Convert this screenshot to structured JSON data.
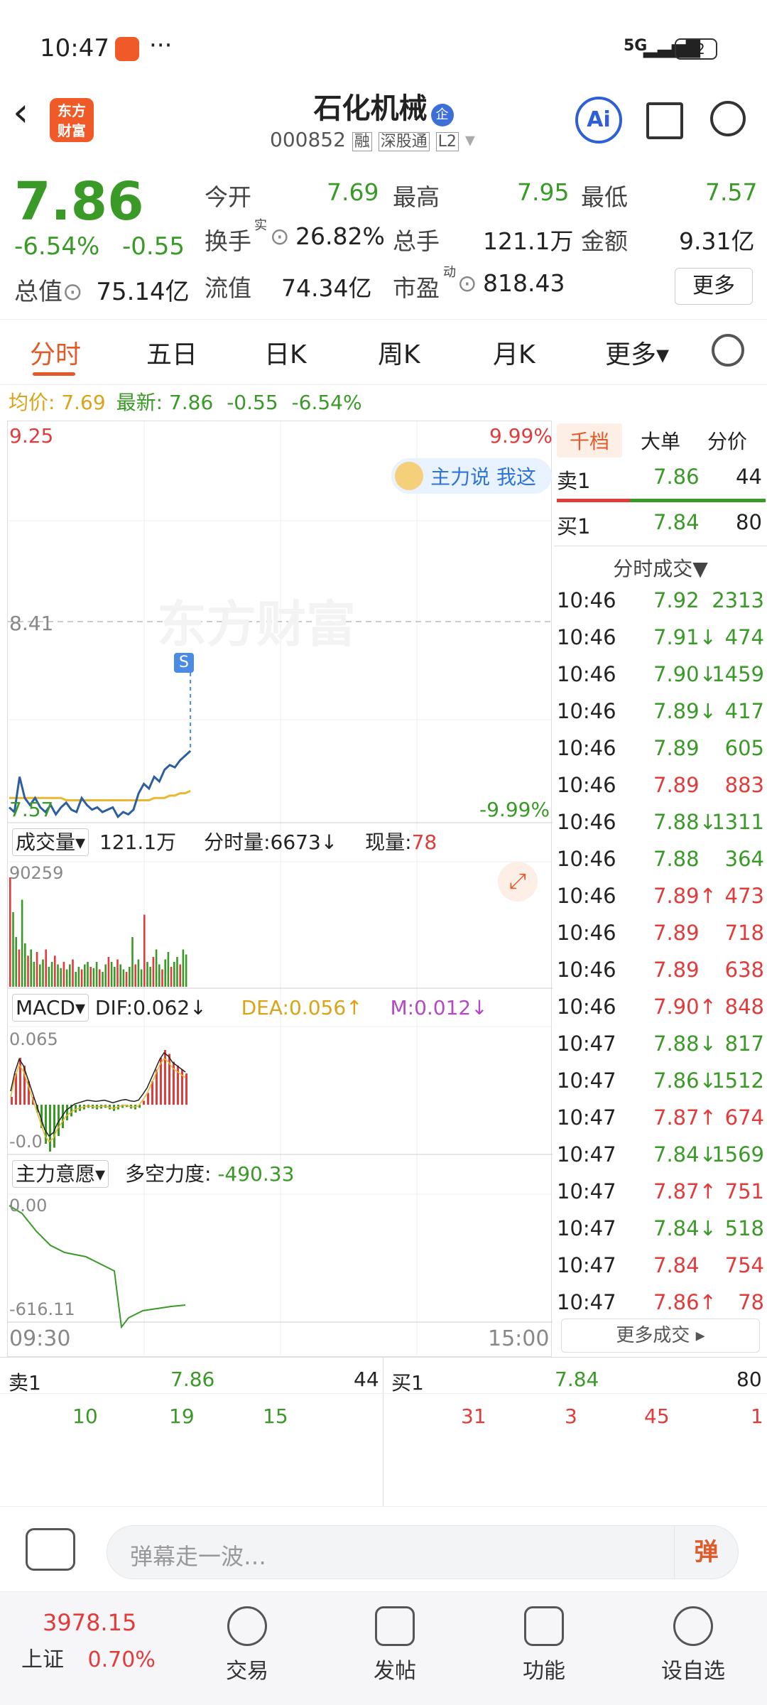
{
  "status": {
    "time": "10:47",
    "dots": "···",
    "network": "5G",
    "battery": "22"
  },
  "header": {
    "app_logo_top": "东方",
    "app_logo_bottom": "财富",
    "stock_name": "石化机械",
    "company_badge": "企",
    "code": "000852",
    "tag_margin": "融",
    "tag_connect": "深股通",
    "tag_l2": "L2"
  },
  "quote": {
    "price": "7.86",
    "change_pct": "-6.54%",
    "change": "-0.55",
    "open_label": "今开",
    "open": "7.69",
    "high_label": "最高",
    "high": "7.95",
    "low_label": "最低",
    "low": "7.57",
    "turnover_label": "换手",
    "turnover_sup": "实",
    "turnover": "26.82%",
    "volume_label": "总手",
    "volume": "121.1万",
    "amount_label": "金额",
    "amount": "9.31亿",
    "mcap_label": "总值",
    "mcap": "75.14亿",
    "float_label": "流值",
    "float": "74.34亿",
    "pe_label": "市盈",
    "pe_sup": "动",
    "pe": "818.43",
    "more": "更多"
  },
  "tabs": [
    "分时",
    "五日",
    "日K",
    "周K",
    "月K",
    "更多▾"
  ],
  "subline": {
    "avg_label": "均价:",
    "avg": "7.69",
    "latest_label": "最新:",
    "latest": "7.86",
    "chg": "-0.55",
    "pct": "-6.54%"
  },
  "chart": {
    "y_top": "9.25",
    "y_mid": "8.41",
    "y_bot": "7.57",
    "pct_top": "9.99%",
    "pct_bot": "-9.99%",
    "watermark": "东方财富",
    "banner": "主力说  我这",
    "marker": "S",
    "vol_label": "成交量",
    "vol_total": "121.1万",
    "fs_label": "分时量:",
    "fs_val": "6673↓",
    "now_label": "现量:",
    "now_val": "78",
    "vol_max": "90259",
    "macd_label": "MACD",
    "dif": "DIF:0.062↓",
    "dea": "DEA:0.056↑",
    "m": "M:0.012↓",
    "macd_top": "0.065",
    "macd_bot": "-0.0",
    "zl_label": "主力意愿",
    "dk_label": "多空力度:",
    "dk_val": "-490.33",
    "zl_top": "0.00",
    "zl_bot": "-616.11",
    "t_start": "09:30",
    "t_end": "15:00",
    "price_line": [
      7.62,
      7.6,
      7.75,
      7.66,
      7.63,
      7.66,
      7.62,
      7.6,
      7.63,
      7.59,
      7.62,
      7.64,
      7.61,
      7.6,
      7.66,
      7.63,
      7.61,
      7.62,
      7.6,
      7.61,
      7.62,
      7.58,
      7.6,
      7.59,
      7.61,
      7.68,
      7.72,
      7.7,
      7.75,
      7.73,
      7.78,
      7.8,
      7.79,
      7.82,
      7.84,
      7.86
    ],
    "avg_line": [
      7.66,
      7.66,
      7.66,
      7.66,
      7.66,
      7.66,
      7.66,
      7.66,
      7.66,
      7.66,
      7.66,
      7.65,
      7.65,
      7.65,
      7.65,
      7.65,
      7.65,
      7.65,
      7.65,
      7.65,
      7.65,
      7.65,
      7.65,
      7.65,
      7.65,
      7.65,
      7.65,
      7.65,
      7.66,
      7.66,
      7.66,
      7.67,
      7.67,
      7.68,
      7.68,
      7.69
    ]
  },
  "side": {
    "tabs": [
      "千档",
      "大单",
      "分价"
    ],
    "sell1": {
      "label": "卖1",
      "price": "7.86",
      "vol": "44"
    },
    "buy1": {
      "label": "买1",
      "price": "7.84",
      "vol": "80"
    },
    "ticks_title": "分时成交▼",
    "ticks": [
      {
        "t": "10:46",
        "p": "7.92",
        "v": "2313",
        "c": "green"
      },
      {
        "t": "10:46",
        "p": "7.91↓",
        "v": "474",
        "c": "green"
      },
      {
        "t": "10:46",
        "p": "7.90↓",
        "v": "1459",
        "c": "green"
      },
      {
        "t": "10:46",
        "p": "7.89↓",
        "v": "417",
        "c": "green"
      },
      {
        "t": "10:46",
        "p": "7.89",
        "v": "605",
        "c": "green"
      },
      {
        "t": "10:46",
        "p": "7.89",
        "v": "883",
        "c": "red"
      },
      {
        "t": "10:46",
        "p": "7.88↓",
        "v": "1311",
        "c": "green"
      },
      {
        "t": "10:46",
        "p": "7.88",
        "v": "364",
        "c": "green"
      },
      {
        "t": "10:46",
        "p": "7.89↑",
        "v": "473",
        "c": "red"
      },
      {
        "t": "10:46",
        "p": "7.89",
        "v": "718",
        "c": "red"
      },
      {
        "t": "10:46",
        "p": "7.89",
        "v": "638",
        "c": "red"
      },
      {
        "t": "10:46",
        "p": "7.90↑",
        "v": "848",
        "c": "red"
      },
      {
        "t": "10:47",
        "p": "7.88↓",
        "v": "817",
        "c": "green"
      },
      {
        "t": "10:47",
        "p": "7.86↓",
        "v": "1512",
        "c": "green"
      },
      {
        "t": "10:47",
        "p": "7.87↑",
        "v": "674",
        "c": "red"
      },
      {
        "t": "10:47",
        "p": "7.84↓",
        "v": "1569",
        "c": "green"
      },
      {
        "t": "10:47",
        "p": "7.87↑",
        "v": "751",
        "c": "red"
      },
      {
        "t": "10:47",
        "p": "7.84↓",
        "v": "518",
        "c": "green"
      },
      {
        "t": "10:47",
        "p": "7.84",
        "v": "754",
        "c": "red"
      },
      {
        "t": "10:47",
        "p": "7.86↑",
        "v": "78",
        "c": "red"
      }
    ],
    "more": "更多成交 ▸"
  },
  "dock": {
    "sell_label": "卖1",
    "sell_price": "7.86",
    "sell_total": "44",
    "sell_orders": [
      "10",
      "19",
      "15"
    ],
    "buy_label": "买1",
    "buy_price": "7.84",
    "buy_total": "80",
    "buy_orders": [
      "31",
      "3",
      "45",
      "1"
    ]
  },
  "input": {
    "placeholder": "弹幕走一波…",
    "danmu_btn": "弹"
  },
  "nav": {
    "index_val": "3978.15",
    "index_name": "上证",
    "index_pct": "0.70%",
    "items": [
      "交易",
      "发帖",
      "功能",
      "设自选"
    ]
  }
}
